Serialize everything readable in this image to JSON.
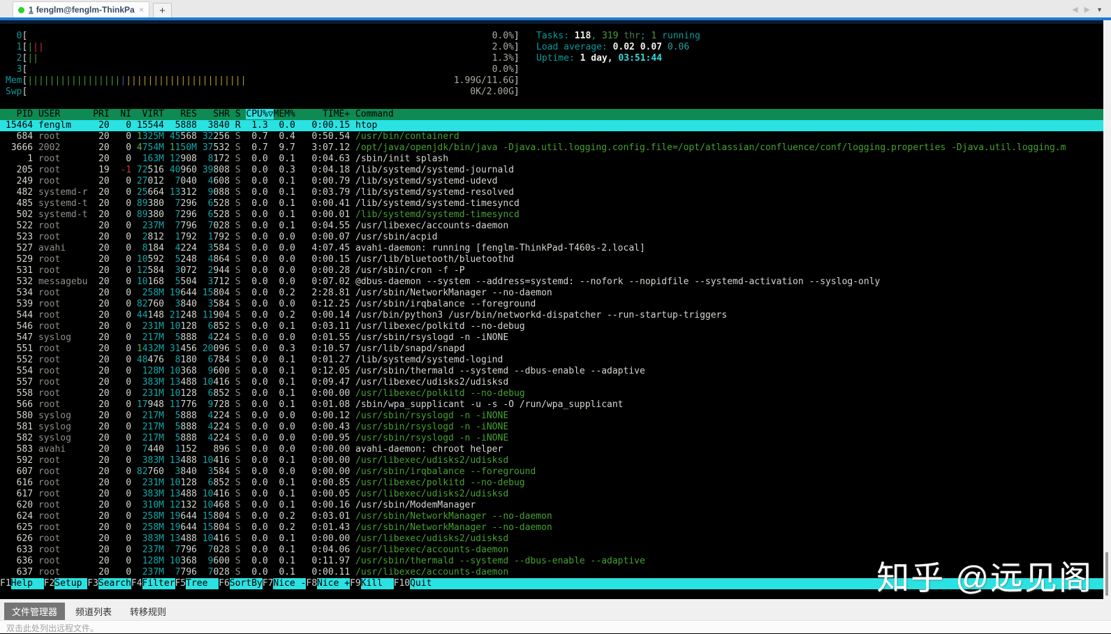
{
  "window": {
    "tab_index": "1",
    "tab_title": "fenglm@fenglm-ThinkPad...",
    "close_glyph": "×",
    "new_tab_glyph": "+",
    "nav_left_glyph": "◀",
    "nav_right_glyph": "▶",
    "menu_glyph": "▼"
  },
  "colors": {
    "fg": "#d3d7cf",
    "dim": "#8f9189",
    "mem": "#0fa9ab",
    "gb": "#55b34a",
    "grn": "#46a232",
    "red": "#c23b2e",
    "cy": "#0b9b9d",
    "mval": "#a9ada3",
    "sel": "#2be2e2",
    "hdrbg": "#0e8a52",
    "barg": "#3f9e2f",
    "barr": "#cc2f2a",
    "barb": "#3465a4",
    "bary": "#b79f1b",
    "wb": "#efefec",
    "bc": "#39dada",
    "tl": "#2f9fa0",
    "dg": "#507a55",
    "accent": "#1d7ad2",
    "navy": "#0d1c30"
  },
  "htop": {
    "meters": [
      {
        "name": "cpu-meter-0",
        "label": "0",
        "bars": [],
        "value": "0.0%"
      },
      {
        "name": "cpu-meter-1",
        "label": "1",
        "bars": [
          [
            "g",
            1
          ],
          [
            "r",
            2
          ]
        ],
        "value": "2.0%"
      },
      {
        "name": "cpu-meter-2",
        "label": "2",
        "bars": [
          [
            "g",
            2
          ]
        ],
        "value": "1.3%"
      },
      {
        "name": "cpu-meter-3",
        "label": "3",
        "bars": [],
        "value": "0.0%"
      },
      {
        "name": "mem-meter",
        "label": "Mem",
        "bars": [
          [
            "g",
            17
          ],
          [
            "b",
            1
          ],
          [
            "y",
            22
          ]
        ],
        "value": "1.99G/11.6G"
      },
      {
        "name": "swp-meter",
        "label": "Swp",
        "bars": [],
        "value": "0K/2.00G"
      }
    ],
    "info_lines": [
      {
        "name": "tasks-summary",
        "segs": [
          [
            "Tasks: ",
            "cy"
          ],
          [
            "118",
            "wb"
          ],
          [
            ", ",
            "cy"
          ],
          [
            "319",
            "g"
          ],
          [
            " thr",
            "dg"
          ],
          [
            "; ",
            "cy"
          ],
          [
            "1",
            "g"
          ],
          [
            " running",
            "cy"
          ]
        ]
      },
      {
        "name": "load-average",
        "segs": [
          [
            "Load average: ",
            "cy"
          ],
          [
            "0.02 ",
            "wb"
          ],
          [
            "0.07 ",
            "wb"
          ],
          [
            "0.06",
            "tl"
          ]
        ]
      },
      {
        "name": "uptime",
        "segs": [
          [
            "Uptime: ",
            "cy"
          ],
          [
            "1 day, ",
            "wb"
          ],
          [
            "03:51:44",
            "bc"
          ]
        ]
      }
    ],
    "header": {
      "pre": "  PID USER      PRI  NI  VIRT   RES   SHR S ",
      "sort": "CPU%▽",
      "post": "MEM%     TIME+ Command"
    },
    "fkeys": [
      {
        "key": "F1",
        "label": "Help  "
      },
      {
        "key": "F2",
        "label": "Setup "
      },
      {
        "key": "F3",
        "label": "Search"
      },
      {
        "key": "F4",
        "label": "Filter"
      },
      {
        "key": "F5",
        "label": "Tree  "
      },
      {
        "key": "F6",
        "label": "SortBy"
      },
      {
        "key": "F7",
        "label": "Nice -"
      },
      {
        "key": "F8",
        "label": "Nice +"
      },
      {
        "key": "F9",
        "label": "Kill  "
      },
      {
        "key": "F10",
        "label": "Quit  "
      }
    ],
    "processes": [
      {
        "pid": "15464",
        "user": "fenglm",
        "pri": "20",
        "ni": "0",
        "virt": "15544",
        "res": "5888",
        "shr": "3840",
        "s": "R",
        "cpu": "1.3",
        "mem": "0.0",
        "time": "0:00.15",
        "cmd": "htop",
        "selected": true
      },
      {
        "pid": "684",
        "user": "root",
        "pri": "20",
        "ni": "0",
        "virt": "1325M",
        "res": "45568",
        "shr": "32256",
        "s": "S",
        "cpu": "0.7",
        "mem": "0.4",
        "time": "0:50.54",
        "cmd": "/usr/bin/containerd",
        "thread": true
      },
      {
        "pid": "3666",
        "user": "2002",
        "pri": "20",
        "ni": "0",
        "virt": "4754M",
        "res": "1150M",
        "shr": "37532",
        "s": "S",
        "cpu": "0.7",
        "mem": "9.7",
        "time": "3:07.12",
        "cmd": "/opt/java/openjdk/bin/java -Djava.util.logging.config.file=/opt/atlassian/confluence/conf/logging.properties -Djava.util.logging.m",
        "thread": true
      },
      {
        "pid": "1",
        "user": "root",
        "pri": "20",
        "ni": "0",
        "virt": "163M",
        "res": "12908",
        "shr": "8172",
        "s": "S",
        "cpu": "0.0",
        "mem": "0.1",
        "time": "0:04.63",
        "cmd": "/sbin/init splash"
      },
      {
        "pid": "205",
        "user": "root",
        "pri": "19",
        "ni": "-1",
        "virt": "72516",
        "res": "40960",
        "shr": "39808",
        "s": "S",
        "cpu": "0.0",
        "mem": "0.3",
        "time": "0:04.18",
        "cmd": "/lib/systemd/systemd-journald"
      },
      {
        "pid": "249",
        "user": "root",
        "pri": "20",
        "ni": "0",
        "virt": "27012",
        "res": "7040",
        "shr": "4608",
        "s": "S",
        "cpu": "0.0",
        "mem": "0.1",
        "time": "0:00.79",
        "cmd": "/lib/systemd/systemd-udevd"
      },
      {
        "pid": "482",
        "user": "systemd-r",
        "pri": "20",
        "ni": "0",
        "virt": "25664",
        "res": "13312",
        "shr": "9088",
        "s": "S",
        "cpu": "0.0",
        "mem": "0.1",
        "time": "0:03.79",
        "cmd": "/lib/systemd/systemd-resolved"
      },
      {
        "pid": "485",
        "user": "systemd-t",
        "pri": "20",
        "ni": "0",
        "virt": "89380",
        "res": "7296",
        "shr": "6528",
        "s": "S",
        "cpu": "0.0",
        "mem": "0.1",
        "time": "0:00.41",
        "cmd": "/lib/systemd/systemd-timesyncd"
      },
      {
        "pid": "502",
        "user": "systemd-t",
        "pri": "20",
        "ni": "0",
        "virt": "89380",
        "res": "7296",
        "shr": "6528",
        "s": "S",
        "cpu": "0.0",
        "mem": "0.1",
        "time": "0:00.01",
        "cmd": "/lib/systemd/systemd-timesyncd",
        "thread": true
      },
      {
        "pid": "522",
        "user": "root",
        "pri": "20",
        "ni": "0",
        "virt": "237M",
        "res": "7796",
        "shr": "7028",
        "s": "S",
        "cpu": "0.0",
        "mem": "0.1",
        "time": "0:04.55",
        "cmd": "/usr/libexec/accounts-daemon"
      },
      {
        "pid": "523",
        "user": "root",
        "pri": "20",
        "ni": "0",
        "virt": "2812",
        "res": "1792",
        "shr": "1792",
        "s": "S",
        "cpu": "0.0",
        "mem": "0.0",
        "time": "0:00.07",
        "cmd": "/usr/sbin/acpid"
      },
      {
        "pid": "527",
        "user": "avahi",
        "pri": "20",
        "ni": "0",
        "virt": "8184",
        "res": "4224",
        "shr": "3584",
        "s": "S",
        "cpu": "0.0",
        "mem": "0.0",
        "time": "4:07.45",
        "cmd": "avahi-daemon: running [fenglm-ThinkPad-T460s-2.local]"
      },
      {
        "pid": "529",
        "user": "root",
        "pri": "20",
        "ni": "0",
        "virt": "10592",
        "res": "5248",
        "shr": "4864",
        "s": "S",
        "cpu": "0.0",
        "mem": "0.0",
        "time": "0:00.15",
        "cmd": "/usr/lib/bluetooth/bluetoothd"
      },
      {
        "pid": "531",
        "user": "root",
        "pri": "20",
        "ni": "0",
        "virt": "12584",
        "res": "3072",
        "shr": "2944",
        "s": "S",
        "cpu": "0.0",
        "mem": "0.0",
        "time": "0:00.28",
        "cmd": "/usr/sbin/cron -f -P"
      },
      {
        "pid": "532",
        "user": "messagebu",
        "pri": "20",
        "ni": "0",
        "virt": "10168",
        "res": "5504",
        "shr": "3712",
        "s": "S",
        "cpu": "0.0",
        "mem": "0.0",
        "time": "0:07.02",
        "cmd": "@dbus-daemon --system --address=systemd: --nofork --nopidfile --systemd-activation --syslog-only"
      },
      {
        "pid": "534",
        "user": "root",
        "pri": "20",
        "ni": "0",
        "virt": "258M",
        "res": "19644",
        "shr": "15804",
        "s": "S",
        "cpu": "0.0",
        "mem": "0.2",
        "time": "2:28.81",
        "cmd": "/usr/sbin/NetworkManager --no-daemon"
      },
      {
        "pid": "539",
        "user": "root",
        "pri": "20",
        "ni": "0",
        "virt": "82760",
        "res": "3840",
        "shr": "3584",
        "s": "S",
        "cpu": "0.0",
        "mem": "0.0",
        "time": "0:12.25",
        "cmd": "/usr/sbin/irqbalance --foreground"
      },
      {
        "pid": "544",
        "user": "root",
        "pri": "20",
        "ni": "0",
        "virt": "44148",
        "res": "21248",
        "shr": "11904",
        "s": "S",
        "cpu": "0.0",
        "mem": "0.2",
        "time": "0:00.14",
        "cmd": "/usr/bin/python3 /usr/bin/networkd-dispatcher --run-startup-triggers"
      },
      {
        "pid": "546",
        "user": "root",
        "pri": "20",
        "ni": "0",
        "virt": "231M",
        "res": "10128",
        "shr": "6852",
        "s": "S",
        "cpu": "0.0",
        "mem": "0.1",
        "time": "0:03.11",
        "cmd": "/usr/libexec/polkitd --no-debug"
      },
      {
        "pid": "547",
        "user": "syslog",
        "pri": "20",
        "ni": "0",
        "virt": "217M",
        "res": "5888",
        "shr": "4224",
        "s": "S",
        "cpu": "0.0",
        "mem": "0.0",
        "time": "0:01.55",
        "cmd": "/usr/sbin/rsyslogd -n -iNONE"
      },
      {
        "pid": "551",
        "user": "root",
        "pri": "20",
        "ni": "0",
        "virt": "1432M",
        "res": "31456",
        "shr": "20096",
        "s": "S",
        "cpu": "0.0",
        "mem": "0.3",
        "time": "0:10.57",
        "cmd": "/usr/lib/snapd/snapd"
      },
      {
        "pid": "552",
        "user": "root",
        "pri": "20",
        "ni": "0",
        "virt": "48476",
        "res": "8180",
        "shr": "6784",
        "s": "S",
        "cpu": "0.0",
        "mem": "0.1",
        "time": "0:01.27",
        "cmd": "/lib/systemd/systemd-logind"
      },
      {
        "pid": "554",
        "user": "root",
        "pri": "20",
        "ni": "0",
        "virt": "128M",
        "res": "10368",
        "shr": "9600",
        "s": "S",
        "cpu": "0.0",
        "mem": "0.1",
        "time": "0:12.05",
        "cmd": "/usr/sbin/thermald --systemd --dbus-enable --adaptive"
      },
      {
        "pid": "557",
        "user": "root",
        "pri": "20",
        "ni": "0",
        "virt": "383M",
        "res": "13488",
        "shr": "10416",
        "s": "S",
        "cpu": "0.0",
        "mem": "0.1",
        "time": "0:09.47",
        "cmd": "/usr/libexec/udisks2/udisksd"
      },
      {
        "pid": "558",
        "user": "root",
        "pri": "20",
        "ni": "0",
        "virt": "231M",
        "res": "10128",
        "shr": "6852",
        "s": "S",
        "cpu": "0.0",
        "mem": "0.1",
        "time": "0:00.00",
        "cmd": "/usr/libexec/polkitd --no-debug",
        "thread": true
      },
      {
        "pid": "566",
        "user": "root",
        "pri": "20",
        "ni": "0",
        "virt": "17948",
        "res": "11776",
        "shr": "9728",
        "s": "S",
        "cpu": "0.0",
        "mem": "0.1",
        "time": "0:01.08",
        "cmd": "/sbin/wpa_supplicant -u -s -O /run/wpa_supplicant"
      },
      {
        "pid": "580",
        "user": "syslog",
        "pri": "20",
        "ni": "0",
        "virt": "217M",
        "res": "5888",
        "shr": "4224",
        "s": "S",
        "cpu": "0.0",
        "mem": "0.0",
        "time": "0:00.12",
        "cmd": "/usr/sbin/rsyslogd -n -iNONE",
        "thread": true
      },
      {
        "pid": "581",
        "user": "syslog",
        "pri": "20",
        "ni": "0",
        "virt": "217M",
        "res": "5888",
        "shr": "4224",
        "s": "S",
        "cpu": "0.0",
        "mem": "0.0",
        "time": "0:00.43",
        "cmd": "/usr/sbin/rsyslogd -n -iNONE",
        "thread": true
      },
      {
        "pid": "582",
        "user": "syslog",
        "pri": "20",
        "ni": "0",
        "virt": "217M",
        "res": "5888",
        "shr": "4224",
        "s": "S",
        "cpu": "0.0",
        "mem": "0.0",
        "time": "0:00.95",
        "cmd": "/usr/sbin/rsyslogd -n -iNONE",
        "thread": true
      },
      {
        "pid": "583",
        "user": "avahi",
        "pri": "20",
        "ni": "0",
        "virt": "7440",
        "res": "1152",
        "shr": "896",
        "s": "S",
        "cpu": "0.0",
        "mem": "0.0",
        "time": "0:00.00",
        "cmd": "avahi-daemon: chroot helper"
      },
      {
        "pid": "592",
        "user": "root",
        "pri": "20",
        "ni": "0",
        "virt": "383M",
        "res": "13488",
        "shr": "10416",
        "s": "S",
        "cpu": "0.0",
        "mem": "0.1",
        "time": "0:00.00",
        "cmd": "/usr/libexec/udisks2/udisksd",
        "thread": true
      },
      {
        "pid": "607",
        "user": "root",
        "pri": "20",
        "ni": "0",
        "virt": "82760",
        "res": "3840",
        "shr": "3584",
        "s": "S",
        "cpu": "0.0",
        "mem": "0.0",
        "time": "0:00.00",
        "cmd": "/usr/sbin/irqbalance --foreground",
        "thread": true
      },
      {
        "pid": "616",
        "user": "root",
        "pri": "20",
        "ni": "0",
        "virt": "231M",
        "res": "10128",
        "shr": "6852",
        "s": "S",
        "cpu": "0.0",
        "mem": "0.1",
        "time": "0:00.85",
        "cmd": "/usr/libexec/polkitd --no-debug",
        "thread": true
      },
      {
        "pid": "617",
        "user": "root",
        "pri": "20",
        "ni": "0",
        "virt": "383M",
        "res": "13488",
        "shr": "10416",
        "s": "S",
        "cpu": "0.0",
        "mem": "0.1",
        "time": "0:00.05",
        "cmd": "/usr/libexec/udisks2/udisksd",
        "thread": true
      },
      {
        "pid": "620",
        "user": "root",
        "pri": "20",
        "ni": "0",
        "virt": "310M",
        "res": "12132",
        "shr": "10468",
        "s": "S",
        "cpu": "0.0",
        "mem": "0.1",
        "time": "0:00.16",
        "cmd": "/usr/sbin/ModemManager"
      },
      {
        "pid": "624",
        "user": "root",
        "pri": "20",
        "ni": "0",
        "virt": "258M",
        "res": "19644",
        "shr": "15804",
        "s": "S",
        "cpu": "0.0",
        "mem": "0.2",
        "time": "0:03.01",
        "cmd": "/usr/sbin/NetworkManager --no-daemon",
        "thread": true
      },
      {
        "pid": "625",
        "user": "root",
        "pri": "20",
        "ni": "0",
        "virt": "258M",
        "res": "19644",
        "shr": "15804",
        "s": "S",
        "cpu": "0.0",
        "mem": "0.2",
        "time": "0:01.43",
        "cmd": "/usr/sbin/NetworkManager --no-daemon",
        "thread": true
      },
      {
        "pid": "626",
        "user": "root",
        "pri": "20",
        "ni": "0",
        "virt": "383M",
        "res": "13488",
        "shr": "10416",
        "s": "S",
        "cpu": "0.0",
        "mem": "0.1",
        "time": "0:00.00",
        "cmd": "/usr/libexec/udisks2/udisksd",
        "thread": true
      },
      {
        "pid": "633",
        "user": "root",
        "pri": "20",
        "ni": "0",
        "virt": "237M",
        "res": "7796",
        "shr": "7028",
        "s": "S",
        "cpu": "0.0",
        "mem": "0.1",
        "time": "0:04.06",
        "cmd": "/usr/libexec/accounts-daemon",
        "thread": true
      },
      {
        "pid": "636",
        "user": "root",
        "pri": "20",
        "ni": "0",
        "virt": "128M",
        "res": "10368",
        "shr": "9600",
        "s": "S",
        "cpu": "0.0",
        "mem": "0.1",
        "time": "0:11.97",
        "cmd": "/usr/sbin/thermald --systemd --dbus-enable --adaptive",
        "thread": true
      },
      {
        "pid": "637",
        "user": "root",
        "pri": "20",
        "ni": "0",
        "virt": "237M",
        "res": "7796",
        "shr": "7028",
        "s": "S",
        "cpu": "0.0",
        "mem": "0.1",
        "time": "0:00.11",
        "cmd": "/usr/libexec/accounts-daemon",
        "thread": true
      }
    ]
  },
  "bottom_panel": {
    "tabs": [
      {
        "label": "文件管理器",
        "selected": true
      },
      {
        "label": "频道列表",
        "selected": false
      },
      {
        "label": "转移规则",
        "selected": false
      }
    ],
    "status_text": "双击此处列出远程文件。"
  },
  "watermark": "知乎 @远见阁"
}
